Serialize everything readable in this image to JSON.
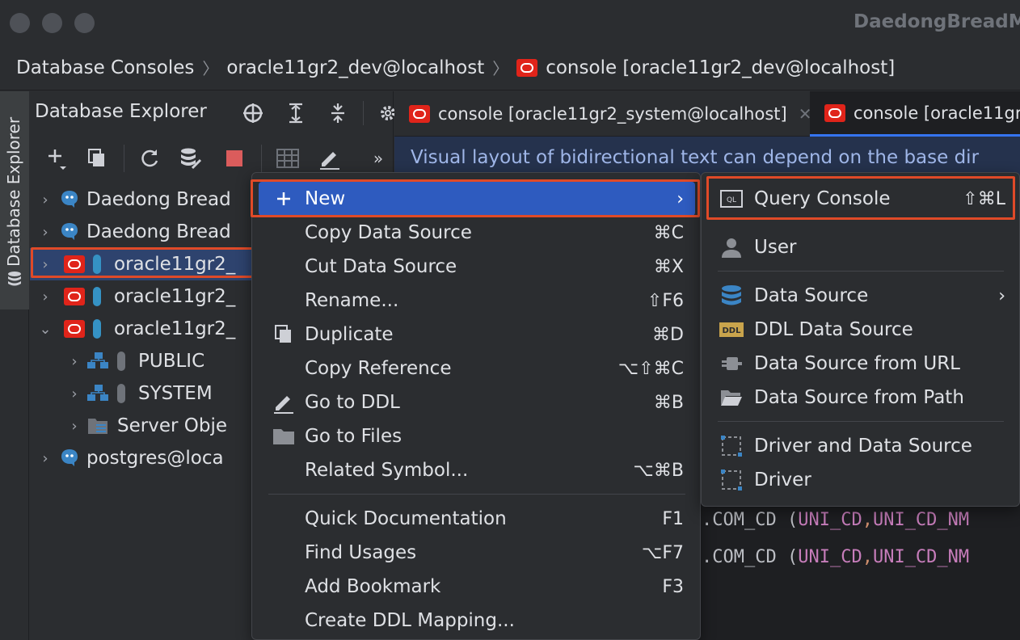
{
  "window": {
    "title": "DaedongBreadM"
  },
  "breadcrumb": {
    "items": [
      "Database Consoles",
      "oracle11gr2_dev@localhost",
      "console [oracle11gr2_dev@localhost]"
    ]
  },
  "left_strip": {
    "tab_label": "Database Explorer"
  },
  "explorer": {
    "title": "Database Explorer",
    "tree": [
      {
        "label": "Daedong Bread",
        "type": "postgres"
      },
      {
        "label": "Daedong Bread",
        "type": "postgres"
      },
      {
        "label": "oracle11gr2_",
        "type": "oracle",
        "selected": true
      },
      {
        "label": "oracle11gr2_",
        "type": "oracle"
      },
      {
        "label": "oracle11gr2_",
        "type": "oracle",
        "expanded": true
      },
      {
        "label": "PUBLIC",
        "type": "schema"
      },
      {
        "label": "SYSTEM",
        "type": "schema"
      },
      {
        "label": "Server Obje",
        "type": "folder"
      },
      {
        "label": "postgres@loca",
        "type": "postgres"
      }
    ]
  },
  "editor": {
    "tabs": [
      {
        "label": "console [oracle11gr2_system@localhost]"
      },
      {
        "label": "console [oracle11gr2"
      }
    ],
    "banner": "Visual layout of bidirectional text can depend on the base dir",
    "code_lines": [
      {
        "table": ".COM_CD (",
        "col1": "UNI_CD",
        "sep": ",",
        "col2": "UNI_CD_NM"
      },
      {
        "table": ".COM_CD (",
        "col1": "UNI_CD",
        "sep": ",",
        "col2": "UNI_CD_NM"
      }
    ]
  },
  "context_menu": {
    "items": [
      {
        "label": "New",
        "shortcut": "",
        "submenu": true,
        "icon": "plus-icon"
      },
      {
        "label": "Copy Data Source",
        "shortcut": "⌘C"
      },
      {
        "label": "Cut Data Source",
        "shortcut": "⌘X"
      },
      {
        "label": "Rename...",
        "shortcut": "⇧F6"
      },
      {
        "label": "Duplicate",
        "shortcut": "⌘D",
        "icon": "duplicate-icon"
      },
      {
        "label": "Copy Reference",
        "shortcut": "⌥⇧⌘C"
      },
      {
        "label": "Go to DDL",
        "shortcut": "⌘B",
        "icon": "pencil-icon"
      },
      {
        "label": "Go to Files",
        "shortcut": "",
        "icon": "folder-icon"
      },
      {
        "label": "Related Symbol...",
        "shortcut": "⌥⌘B"
      },
      {
        "label": "Quick Documentation",
        "shortcut": "F1"
      },
      {
        "label": "Find Usages",
        "shortcut": "⌥F7"
      },
      {
        "label": "Add Bookmark",
        "shortcut": "F3"
      },
      {
        "label": "Create DDL Mapping...",
        "shortcut": ""
      }
    ]
  },
  "submenu": {
    "items": [
      {
        "label": "Query Console",
        "shortcut": "⇧⌘L",
        "icon": "query-console-icon",
        "icon_text": "QL"
      },
      {
        "label": "User",
        "shortcut": "",
        "icon": "user-icon"
      },
      {
        "label": "Data Source",
        "shortcut": "",
        "submenu": true,
        "icon": "data-source-icon"
      },
      {
        "label": "DDL Data Source",
        "shortcut": "",
        "icon": "ddl-icon",
        "icon_text": "DDL"
      },
      {
        "label": "Data Source from URL",
        "shortcut": "",
        "icon": "url-plug-icon"
      },
      {
        "label": "Data Source from Path",
        "shortcut": "",
        "icon": "open-folder-icon"
      },
      {
        "label": "Driver and Data Source",
        "shortcut": "",
        "icon": "driver-datasource-icon"
      },
      {
        "label": "Driver",
        "shortcut": "",
        "icon": "driver-icon"
      }
    ]
  },
  "colors": {
    "accent": "#2e5bbf",
    "highlight_border": "#e04a28",
    "oracle_red": "#e0241a",
    "background": "#2b2d30"
  }
}
